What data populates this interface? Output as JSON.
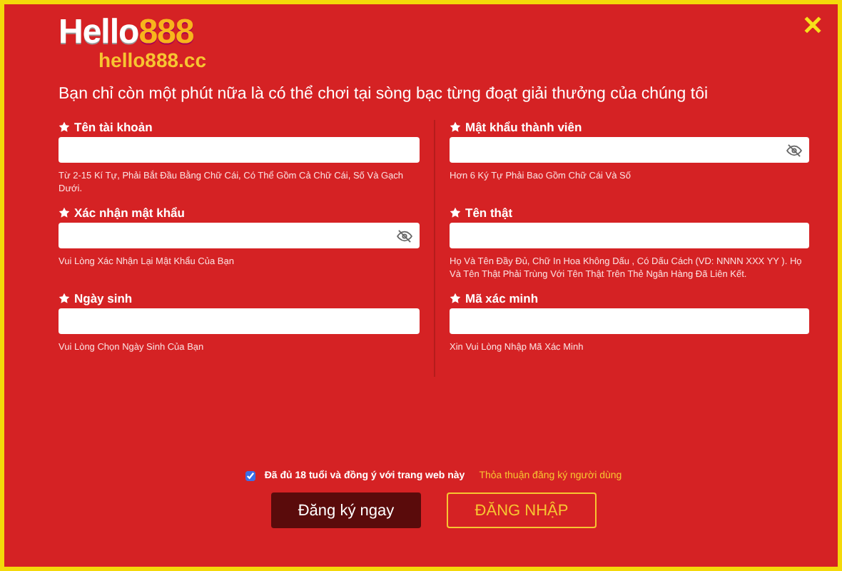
{
  "logo": {
    "word": "Hello",
    "number": "888",
    "domain": "hello888.cc"
  },
  "close": "✕",
  "subtitle": "Bạn chỉ còn một phút nữa là có thể chơi tại sòng bạc từng đoạt giải thưởng của chúng tôi",
  "columns": [
    [
      {
        "label": "Tên tài khoản",
        "kind": "text",
        "hint": "Từ 2-15 Kí Tự, Phải Bắt Đầu Bằng Chữ Cái, Có Thể Gồm Cả Chữ Cái, Số Và Gạch Dưới."
      },
      {
        "label": "Xác nhận mật khẩu",
        "kind": "password",
        "hint": "Vui Lòng Xác Nhận Lại Mật Khẩu Của Bạn"
      },
      {
        "label": "Ngày sinh",
        "kind": "text",
        "hint": "Vui Lòng Chọn Ngày Sinh Của Bạn"
      }
    ],
    [
      {
        "label": "Mật khẩu thành viên",
        "kind": "password",
        "hint": "Hơn 6 Ký Tự Phải Bao Gồm Chữ Cái Và Số"
      },
      {
        "label": "Tên thật",
        "kind": "text",
        "hint": "Họ Và Tên Đầy Đủ, Chữ In Hoa Không Dấu , Có Dấu Cách (VD: NNNN XXX YY ). Họ Và Tên Thật Phải Trùng Với Tên Thật Trên Thẻ Ngân Hàng Đã Liên Kết."
      },
      {
        "label": "Mã xác minh",
        "kind": "text",
        "hint": "Xin Vui Lòng Nhập Mã Xác Minh"
      }
    ]
  ],
  "agree": {
    "checked": true,
    "label": "Đã đủ 18 tuổi và đồng ý với trang web này",
    "link": "Thỏa thuận đăng ký người dùng"
  },
  "buttons": [
    {
      "label": "Đăng ký ngay",
      "kind": "primary"
    },
    {
      "label": "ĐĂNG NHẬP",
      "kind": "outline"
    }
  ]
}
